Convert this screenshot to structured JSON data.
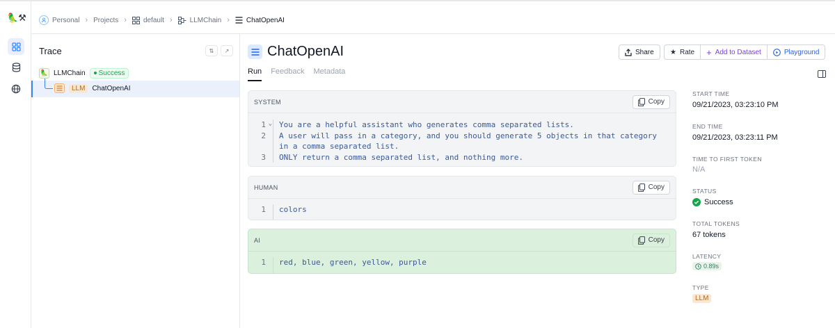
{
  "breadcrumb": {
    "items": [
      "Personal",
      "Projects",
      "default",
      "LLMChain",
      "ChatOpenAI"
    ]
  },
  "rail": {
    "logo": "🦜⚒",
    "icons": [
      "grid-icon",
      "database-icon",
      "globe-icon"
    ]
  },
  "trace": {
    "title": "Trace",
    "root": {
      "name": "LLMChain",
      "status": "Success",
      "icon": "🦜"
    },
    "child": {
      "badge": "LLM",
      "name": "ChatOpenAI"
    }
  },
  "run": {
    "title": "ChatOpenAI",
    "actions": {
      "share": "Share",
      "rate": "Rate",
      "add_to_dataset": "Add to Dataset",
      "playground": "Playground"
    },
    "tabs": [
      "Run",
      "Feedback",
      "Metadata"
    ],
    "active_tab": "Run"
  },
  "messages": [
    {
      "role": "SYSTEM",
      "copy": "Copy",
      "line_numbers": [
        "1",
        "2",
        "",
        "3"
      ],
      "fold_marker": "⌄",
      "lines": [
        "You are a helpful assistant who generates comma separated lists.",
        "A user will pass in a category, and you should generate 5 objects in that category",
        "in a comma separated list.",
        "ONLY return a comma separated list, and nothing more."
      ]
    },
    {
      "role": "HUMAN",
      "copy": "Copy",
      "line_numbers": [
        "1"
      ],
      "lines": [
        "colors"
      ]
    },
    {
      "role": "AI",
      "copy": "Copy",
      "line_numbers": [
        "1"
      ],
      "lines": [
        "red, blue, green, yellow, purple"
      ]
    }
  ],
  "meta": {
    "start_time_label": "START TIME",
    "start_time": "09/21/2023, 03:23:10 PM",
    "end_time_label": "END TIME",
    "end_time": "09/21/2023, 03:23:11 PM",
    "ttft_label": "TIME TO FIRST TOKEN",
    "ttft": "N/A",
    "status_label": "STATUS",
    "status": "Success",
    "tokens_label": "TOTAL TOKENS",
    "tokens": "67 tokens",
    "latency_label": "LATENCY",
    "latency": "0.89s",
    "type_label": "TYPE",
    "type": "LLM"
  },
  "colors": {
    "accent": "#3b82f6",
    "success": "#16a34a",
    "llm_badge_bg": "#fde7cc",
    "ai_bg": "#dcf0de"
  }
}
